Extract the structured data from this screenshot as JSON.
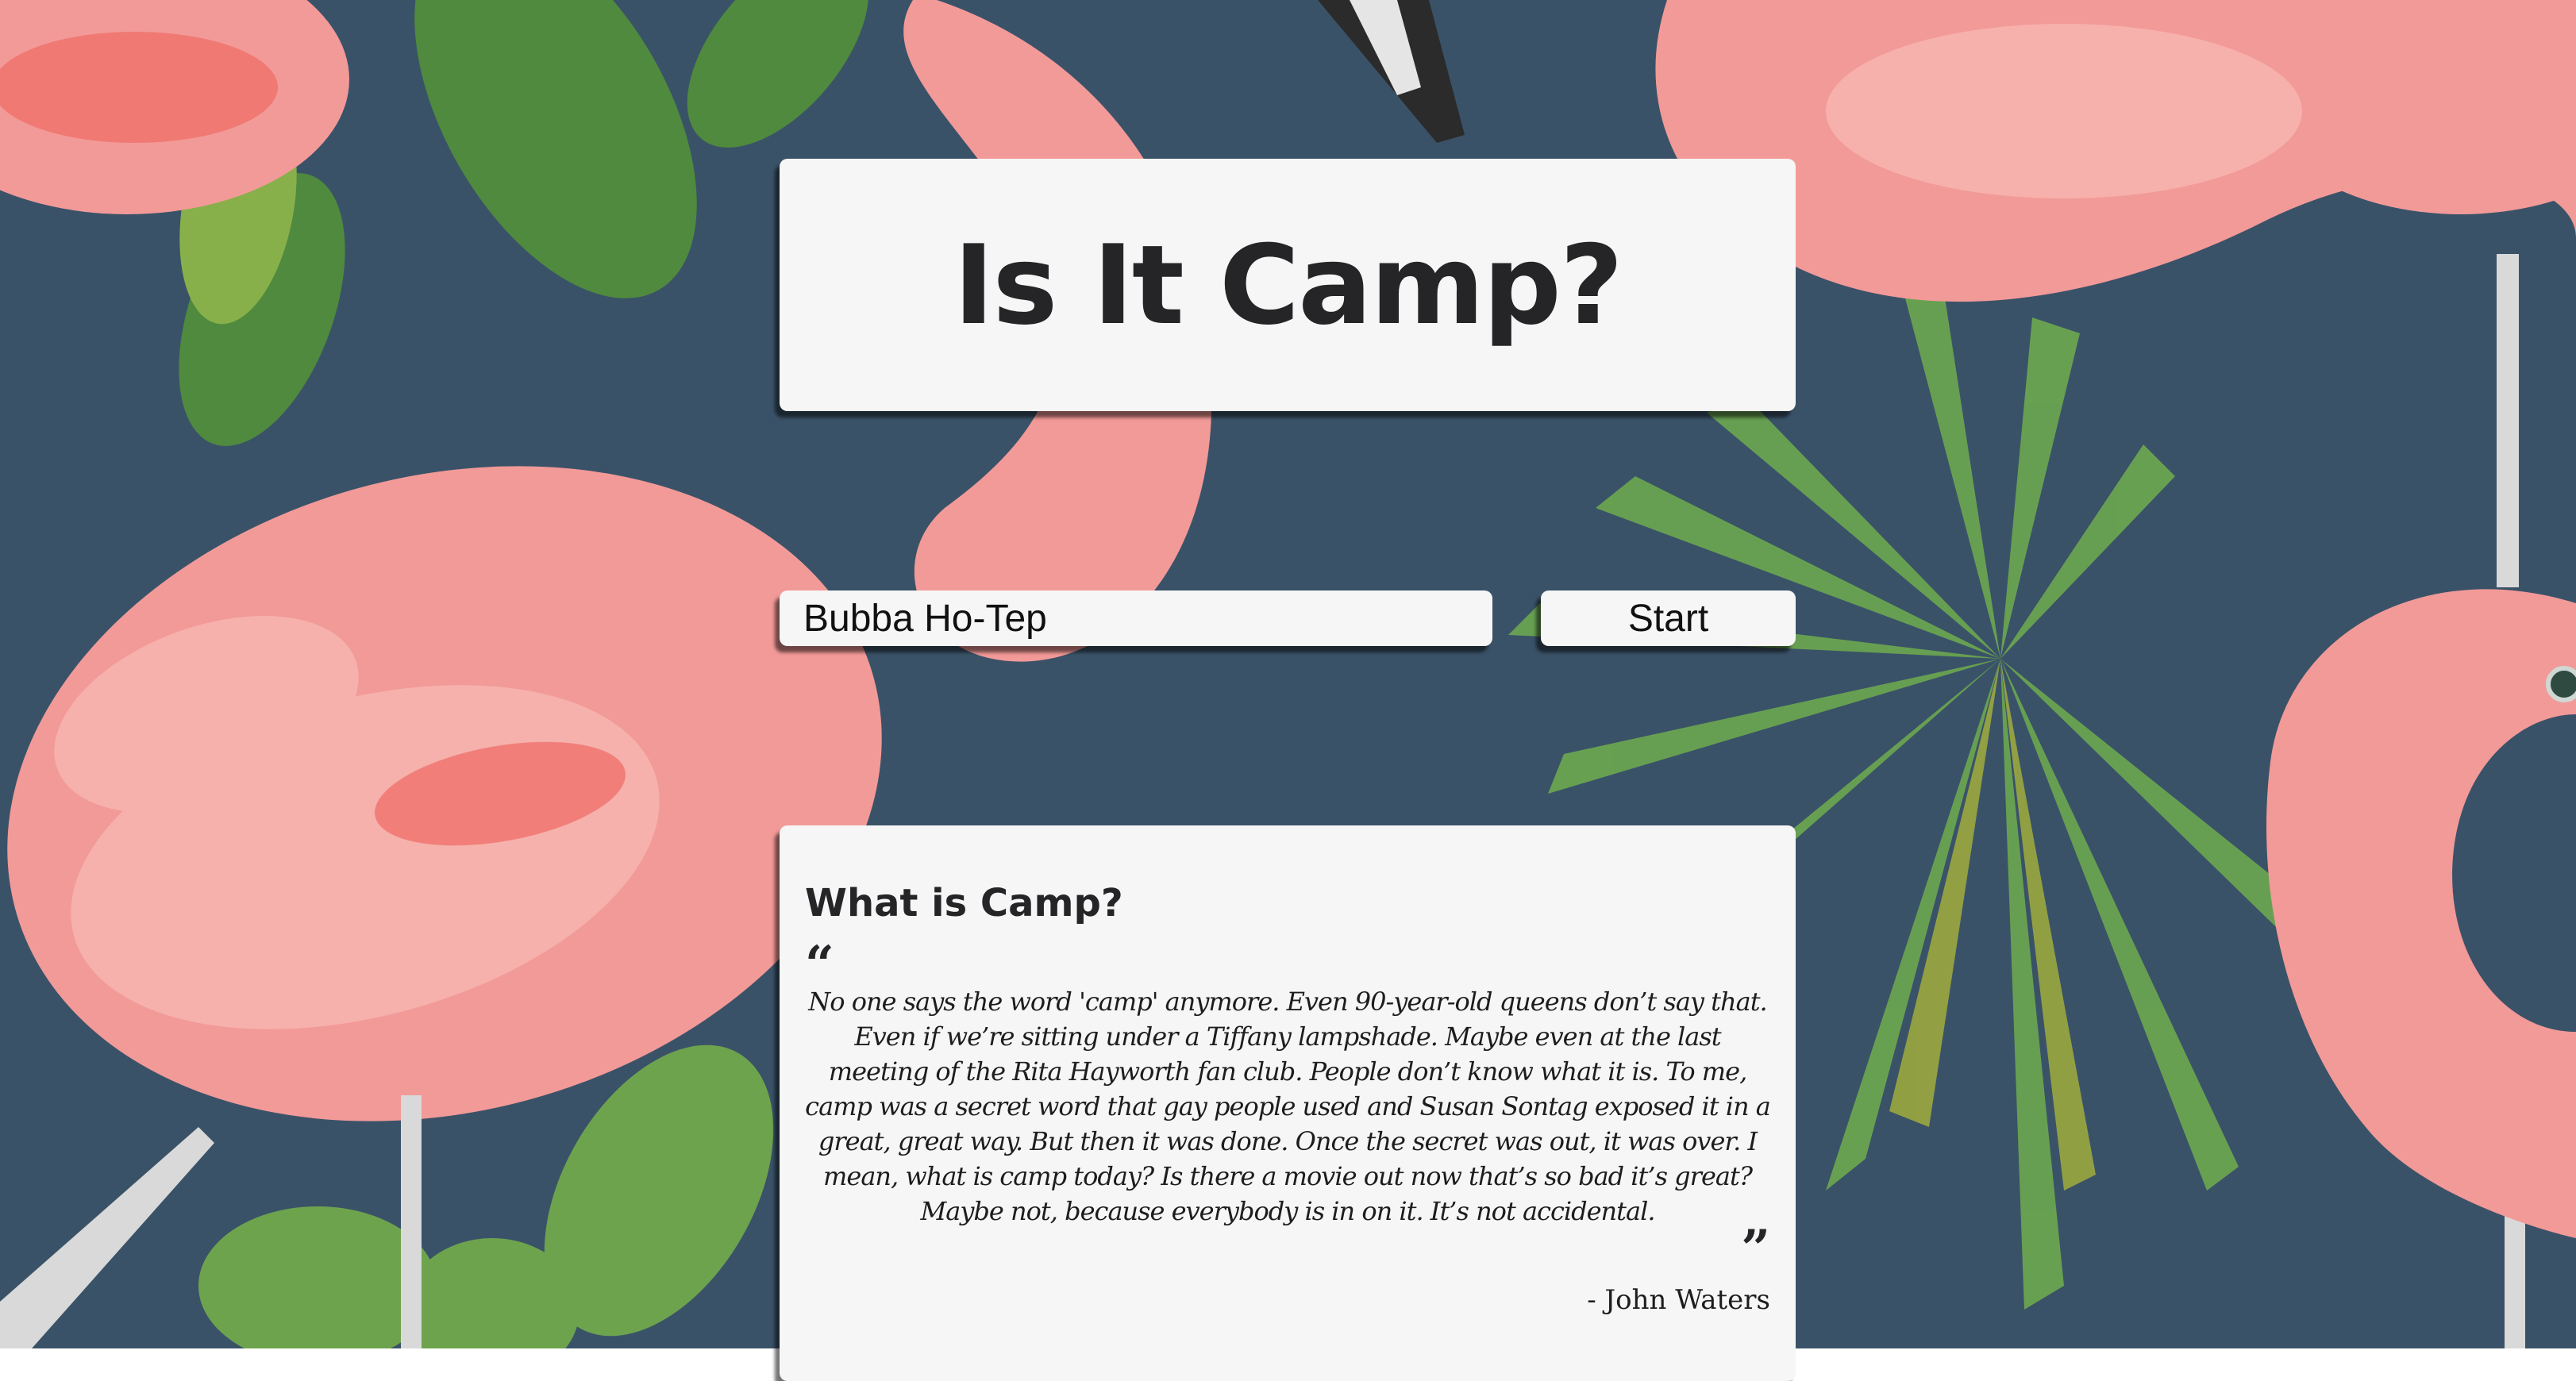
{
  "header": {
    "title": "Is It Camp?"
  },
  "search": {
    "value": "Bubba Ho-Tep",
    "placeholder": ""
  },
  "start_button": {
    "label": "Start"
  },
  "info": {
    "heading": "What is Camp?",
    "open_quote": "“",
    "quote": "No one says the word 'camp' anymore. Even 90-year-old queens don’t say that. Even if we’re sitting under a Tiffany lampshade. Maybe even at the last meeting of the Rita Hayworth fan club. People don’t know what it is. To me, camp was a secret word that gay people used and Susan Sontag exposed it in a great, great way. But then it was done. Once the secret was out, it was over. I mean, what is camp today? Is there a movie out now that’s so bad it’s great? Maybe not, because everybody is in on it. It’s not accidental.",
    "close_quote": "”",
    "author": "- John Waters"
  },
  "colors": {
    "background": "#3a5268",
    "card": "#f6f6f6",
    "text": "#252528",
    "flamingo_pink": "#f29a98",
    "leaf_green": "#5e9a4a"
  },
  "background_image": {
    "icon": "flamingo-palm-wallpaper"
  }
}
